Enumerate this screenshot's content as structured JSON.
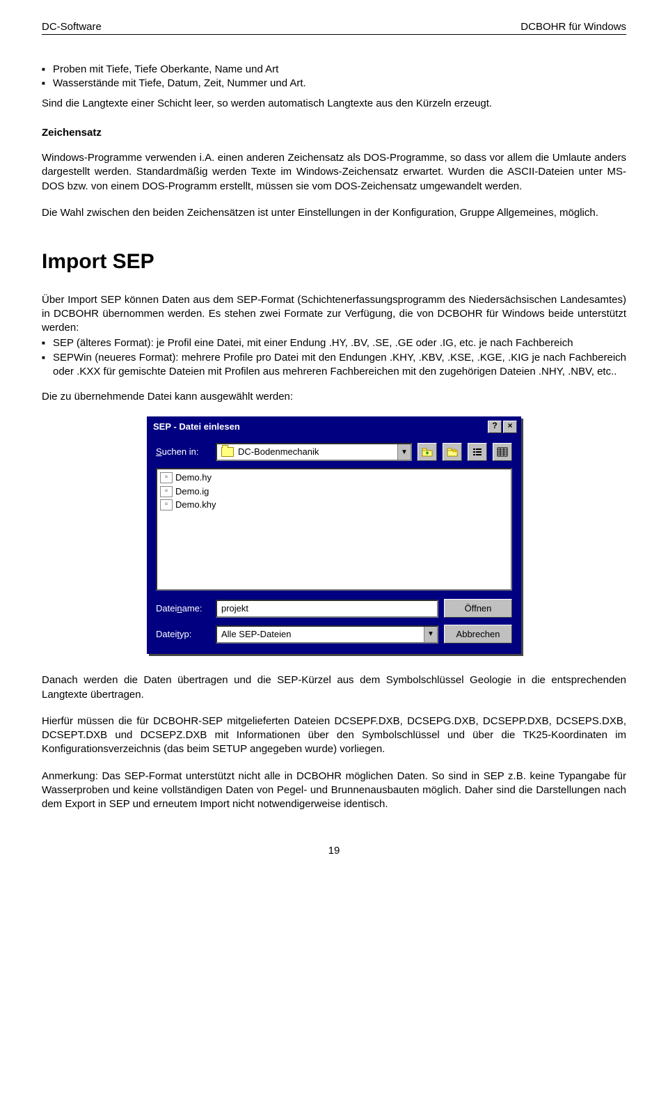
{
  "header": {
    "left": "DC-Software",
    "right": "DCBOHR für Windows"
  },
  "intro": {
    "bullets": [
      "Proben mit Tiefe, Tiefe Oberkante, Name und Art",
      "Wasserstände mit Tiefe, Datum, Zeit, Nummer und Art."
    ],
    "after": "Sind die Langtexte einer Schicht leer, so werden automatisch Langtexte aus den Kürzeln erzeugt."
  },
  "zeichensatz": {
    "title": "Zeichensatz",
    "p1": "Windows-Programme verwenden i.A. einen anderen Zeichensatz als DOS-Programme, so dass vor allem die Umlaute anders dargestellt werden. Standardmäßig werden Texte im Windows-Zeichensatz erwartet. Wurden die ASCII-Dateien unter MS-DOS bzw. von einem DOS-Programm erstellt, müssen sie vom DOS-Zeichensatz umgewandelt werden.",
    "p2": "Die Wahl zwischen den beiden Zeichensätzen ist unter Einstellungen in der Konfiguration, Gruppe Allgemeines, möglich."
  },
  "importSep": {
    "heading": "Import SEP",
    "p1": "Über Import SEP können Daten aus dem SEP-Format (Schichtenerfassungsprogramm des Niedersächsischen Landesamtes) in DCBOHR übernommen werden. Es stehen zwei Formate zur Verfügung, die von DCBOHR für Windows beide unterstützt werden:",
    "bullets": [
      "SEP (älteres Format): je Profil eine Datei, mit einer Endung .HY, .BV, .SE, .GE oder .IG, etc. je nach Fachbereich",
      "SEPWin (neueres Format): mehrere Profile pro Datei mit den Endungen .KHY, .KBV, .KSE, .KGE, .KIG je nach Fachbereich oder .KXX für gemischte Dateien mit Profilen aus mehreren Fachbereichen mit den zugehörigen Dateien .NHY, .NBV, etc.."
    ],
    "p2": "Die zu übernehmende Datei kann ausgewählt werden:"
  },
  "dialog": {
    "title": "SEP - Datei einlesen",
    "helpGlyph": "?",
    "closeGlyph": "×",
    "searchLabel": "Suchen in:",
    "folder": "DC-Bodenmechanik",
    "files": [
      "Demo.hy",
      "Demo.ig",
      "Demo.khy"
    ],
    "filenameLabel": "Dateiname:",
    "filenameValue": "projekt",
    "filetypeLabel": "Dateityp:",
    "filetypeValue": "Alle SEP-Dateien",
    "openBtn": "Öffnen",
    "cancelBtn": "Abbrechen"
  },
  "after": {
    "p1": "Danach werden die Daten übertragen und die SEP-Kürzel aus dem Symbolschlüssel Geologie in die entsprechenden Langtexte übertragen.",
    "p2": "Hierfür müssen die für DCBOHR-SEP mitgelieferten Dateien DCSEPF.DXB, DCSEPG.DXB, DCSEPP.DXB, DCSEPS.DXB, DCSEPT.DXB und DCSEPZ.DXB mit Informationen über den Symbolschlüssel und über die TK25-Koordinaten im Konfigurationsverzeichnis (das beim SETUP angegeben wurde) vorliegen.",
    "p3": "Anmerkung: Das SEP-Format unterstützt nicht alle in DCBOHR möglichen Daten. So sind in SEP z.B. keine Typangabe für Wasserproben und keine vollständigen Daten von Pegel- und Brunnenausbauten möglich. Daher sind die Darstellungen nach dem Export in SEP und erneutem Import nicht notwendigerweise identisch."
  },
  "pageNumber": "19"
}
